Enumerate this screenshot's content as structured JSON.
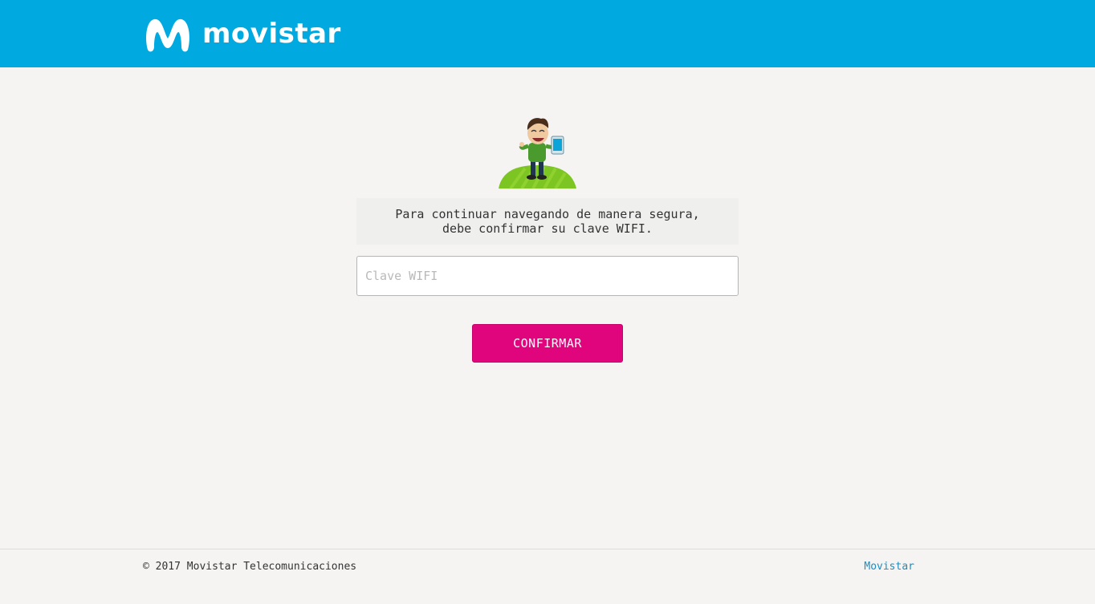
{
  "header": {
    "brand": "movistar",
    "logo_icon": "movistar-m-logo",
    "background_color": "#00a9e0"
  },
  "main": {
    "illustration": "smiling-man-holding-phone-on-green-hill",
    "message": "Para continuar navegando de manera segura,\ndebe confirmar su clave WIFI.",
    "wifi_input": {
      "placeholder": "Clave WIFI",
      "value": ""
    },
    "confirm_button": {
      "label": "CONFIRMAR",
      "color": "#e0057c"
    }
  },
  "footer": {
    "copyright": "© 2017 Movistar Telecomunicaciones",
    "link_label": "Movistar",
    "link_color": "#1a8ec2"
  }
}
